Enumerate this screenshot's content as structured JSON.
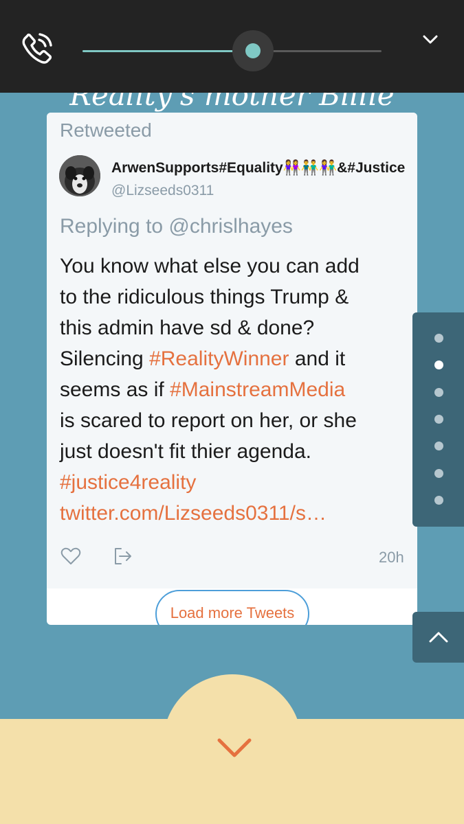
{
  "call_bar": {
    "progress": 0.57,
    "accent_color": "#7fc8c4",
    "left_icon": "phone-in-call-icon",
    "right_icon": "chevron-down-icon"
  },
  "background": {
    "heading": "Reality's mother Billie"
  },
  "tweet": {
    "retweeted_label": "Retweeted",
    "display_name": "ArwenSupports#Equality👭👬👫&#Justice",
    "handle": "@Lizseeds0311",
    "reply_line": "Replying to @chrislhayes",
    "text_lines": [
      "You know what else you can add",
      "to the ridiculous things Trump &",
      "this admin have sd & done?"
    ],
    "line4_prefix": "Silencing ",
    "hashtag_reality_winner": "#RealityWinner",
    "line4_suffix": " and it",
    "line5_prefix": "seems as if ",
    "hashtag_mainstream_media": "#MainstreamMedia",
    "line6": "is scared to report on her, or she",
    "line7": "just doesn't fit thier agenda.",
    "hashtag_justice": "#justice4reality",
    "link": "twitter.com/Lizseeds0311/s…",
    "timestamp": "20h",
    "highlight_color": "#e5713f"
  },
  "load_more_label": "Load more Tweets",
  "dot_nav": {
    "count": 7,
    "active_index": 1
  },
  "icons": {
    "like": "heart-outline-icon",
    "share": "share-arrow-icon",
    "scroll_top": "chevron-up-icon",
    "scroll_down": "chevron-down-icon"
  }
}
